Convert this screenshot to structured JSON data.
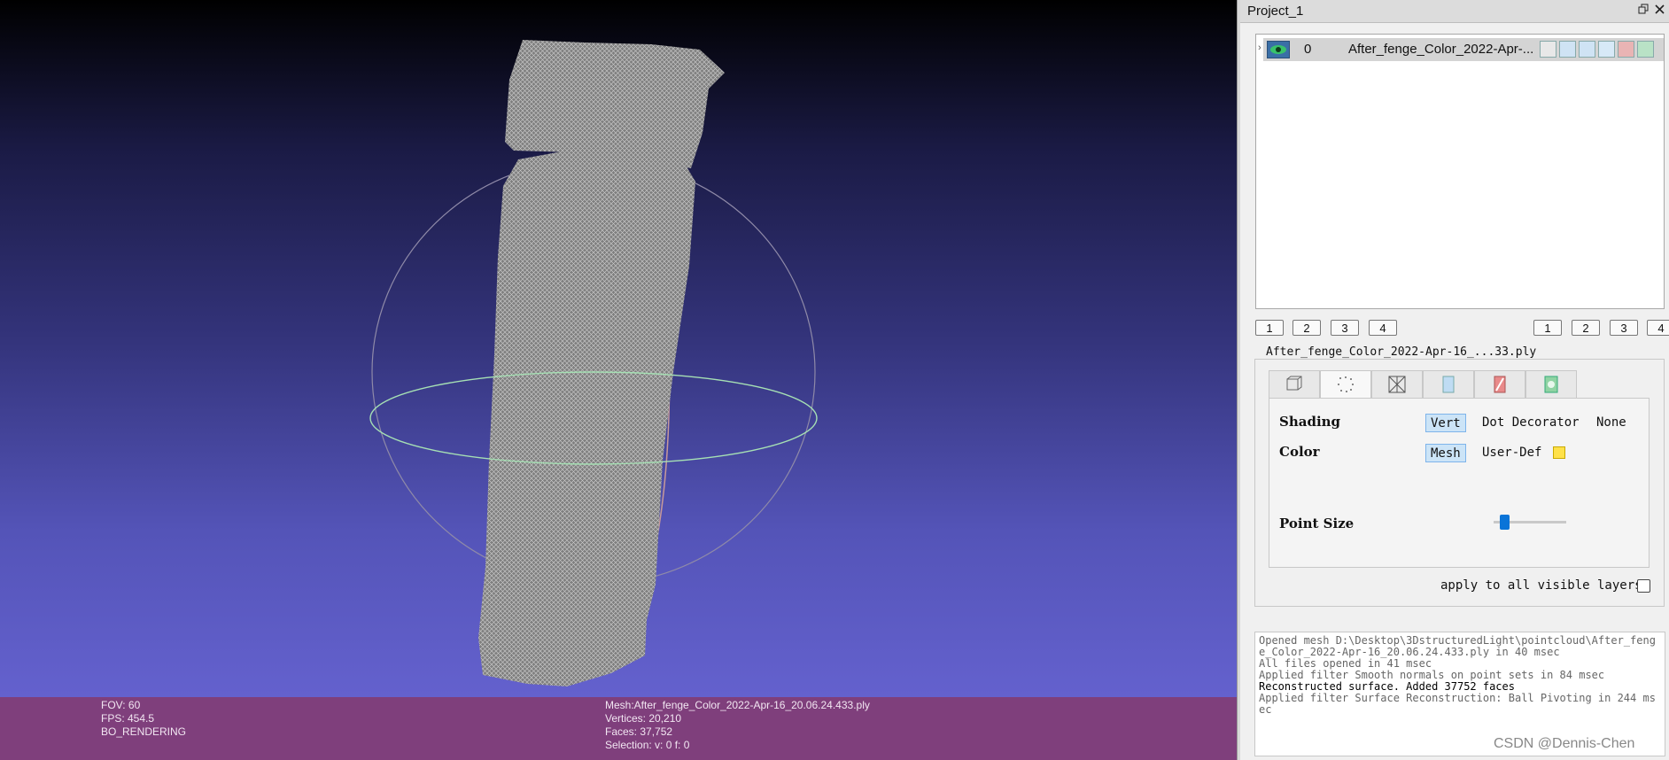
{
  "viewport": {
    "info_left": {
      "fov": "FOV: 60",
      "fps": "FPS:   454.5",
      "mode": "BO_RENDERING"
    },
    "info_mesh": {
      "mesh": "Mesh:After_fenge_Color_2022-Apr-16_20.06.24.433.ply",
      "vertices": "Vertices: 20,210",
      "faces": "Faces: 37,752",
      "selection": "Selection: v: 0 f: 0"
    }
  },
  "panel": {
    "title": "Project_1",
    "restore_icon": "restore-icon",
    "close_icon": "close-icon",
    "layers": [
      {
        "index": "0",
        "name": "After_fenge_Color_2022-Apr-...",
        "visible": true
      }
    ],
    "left_buttons": [
      "1",
      "2",
      "3",
      "4"
    ],
    "right_buttons": [
      "1",
      "2",
      "3",
      "4"
    ],
    "mesh_group_title": "After_fenge_Color_2022-Apr-16_...33.ply",
    "tabs": [
      "box-icon",
      "points-icon",
      "wireframe-icon",
      "flat-shading-icon",
      "texture-icon",
      "smooth-icon"
    ],
    "active_tab": 1,
    "shading": {
      "label": "Shading",
      "options": [
        "Vert",
        "Dot Decorator",
        "None"
      ],
      "selected": "Vert"
    },
    "color": {
      "label": "Color",
      "options": [
        "Mesh",
        "User-Def"
      ],
      "selected": "Mesh",
      "swatch": "#ffe14a"
    },
    "point_size": {
      "label": "Point Size",
      "value_fraction": 0.1
    },
    "apply_all": {
      "label": "apply to all visible layers",
      "checked": false
    }
  },
  "log": [
    {
      "text": "Opened mesh D:\\Desktop\\3DstructuredLight\\pointcloud\\After_fenge_Color_2022-Apr-16_20.06.24.433.ply in 40 msec",
      "bold": false
    },
    {
      "text": "All files opened in 41 msec",
      "bold": false
    },
    {
      "text": "Applied filter Smooth normals on point sets in 84 msec",
      "bold": false
    },
    {
      "text": "Reconstructed surface. Added 37752 faces",
      "bold": true
    },
    {
      "text": "Applied filter Surface Reconstruction: Ball Pivoting in 244 msec",
      "bold": false
    }
  ],
  "watermark": "CSDN @Dennis-Chen",
  "colors": {
    "info_bar": "#7f3f7c",
    "accent": "#0a74d8",
    "selected_option": "#cce4f7"
  }
}
